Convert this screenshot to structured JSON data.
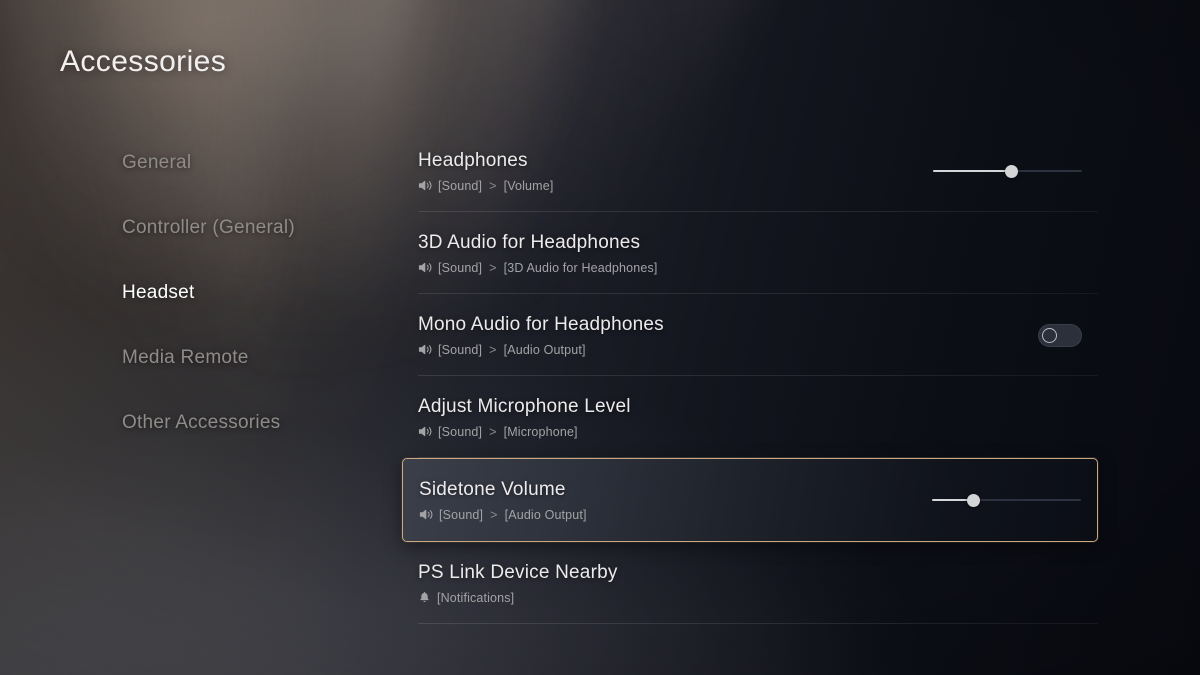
{
  "header": {
    "title": "Accessories"
  },
  "sidebar": {
    "items": [
      {
        "label": "General",
        "active": false
      },
      {
        "label": "Controller (General)",
        "active": false
      },
      {
        "label": "Headset",
        "active": true
      },
      {
        "label": "Media Remote",
        "active": false
      },
      {
        "label": "Other Accessories",
        "active": false
      }
    ]
  },
  "main": {
    "rows": [
      {
        "title": "Headphones",
        "icon": "speaker-icon",
        "breadcrumb": [
          "[Sound]",
          "[Volume]"
        ],
        "breadcrumb_text": "[Sound] > [Volume]",
        "control": "slider",
        "slider_value": 53,
        "focused": false
      },
      {
        "title": "3D Audio for Headphones",
        "icon": "speaker-icon",
        "breadcrumb": [
          "[Sound]",
          "[3D Audio for Headphones]"
        ],
        "breadcrumb_text": "[Sound] > [3D Audio for Headphones]",
        "control": "none",
        "focused": false
      },
      {
        "title": "Mono Audio for Headphones",
        "icon": "speaker-icon",
        "breadcrumb": [
          "[Sound]",
          "[Audio Output]"
        ],
        "breadcrumb_text": "[Sound] > [Audio Output]",
        "control": "toggle",
        "toggle_on": false,
        "focused": false
      },
      {
        "title": "Adjust Microphone Level",
        "icon": "speaker-icon",
        "breadcrumb": [
          "[Sound]",
          "[Microphone]"
        ],
        "breadcrumb_text": "[Sound] > [Microphone]",
        "control": "none",
        "focused": false
      },
      {
        "title": "Sidetone Volume",
        "icon": "speaker-icon",
        "breadcrumb": [
          "[Sound]",
          "[Audio Output]"
        ],
        "breadcrumb_text": "[Sound] > [Audio Output]",
        "control": "slider",
        "slider_value": 28,
        "focused": true
      },
      {
        "title": "PS Link Device Nearby",
        "icon": "bell-icon",
        "breadcrumb": [
          "[Notifications]"
        ],
        "breadcrumb_text": "[Notifications]",
        "control": "none",
        "focused": false
      }
    ],
    "crumb_separator": ">"
  },
  "colors": {
    "focus_border": "#c9a87e",
    "active_text": "#ffffff",
    "inactive_text": "#8f8b88",
    "slider_fill": "#d5d6d8",
    "slider_track": "#2c3240",
    "background_dark": "#0a0c14"
  }
}
